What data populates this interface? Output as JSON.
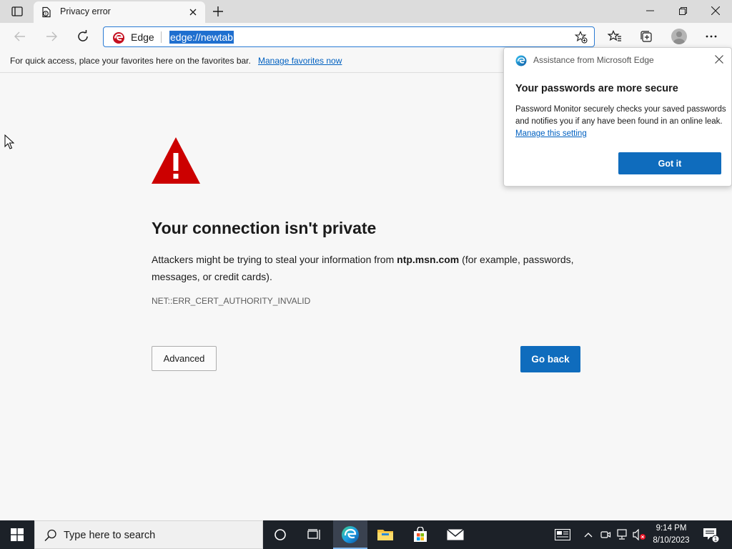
{
  "tab": {
    "title": "Privacy error",
    "favicon": "privacy-error-page-icon",
    "close_icon": "close-icon",
    "new_tab_icon": "plus-icon"
  },
  "window_controls": {
    "minimize": "minimize-icon",
    "restore": "restore-icon",
    "close": "close-icon"
  },
  "toolbar": {
    "back_icon": "back-arrow-icon",
    "forward_icon": "forward-arrow-icon",
    "refresh_icon": "refresh-icon",
    "address_brand": "Edge",
    "address_url": "edge://newtab",
    "add_favorite_icon": "star-plus-icon",
    "favorites_icon": "favorites-icon",
    "collections_icon": "collections-icon",
    "profile_icon": "profile-avatar-icon",
    "menu_icon": "more-dots-icon"
  },
  "favorites_bar": {
    "text": "For quick access, place your favorites here on the favorites bar.",
    "link": "Manage favorites now"
  },
  "error_page": {
    "icon": "warning-triangle-icon",
    "heading": "Your connection isn't private",
    "description_before": "Attackers might be trying to steal your information from ",
    "host": "ntp.msn.com",
    "description_after": " (for example, passwords, messages, or credit cards).",
    "error_code": "NET::ERR_CERT_AUTHORITY_INVALID",
    "advanced_button": "Advanced",
    "go_back_button": "Go back"
  },
  "popup": {
    "header": "Assistance from Microsoft Edge",
    "title": "Your passwords are more secure",
    "body": "Password Monitor securely checks your saved passwords and notifies you if any have been found in an online leak.",
    "link": "Manage this setting",
    "button": "Got it"
  },
  "taskbar": {
    "search_placeholder": "Type here to search",
    "apps": [
      "cortana-icon",
      "task-view-icon",
      "edge-icon",
      "file-explorer-icon",
      "store-icon",
      "mail-icon"
    ],
    "time": "9:14 PM",
    "date": "8/10/2023",
    "notification_count": "1"
  },
  "colors": {
    "accent_blue": "#0f6cbd",
    "link_blue": "#0060c0",
    "warning_red": "#cc0000",
    "taskbar_bg": "#1c2128"
  }
}
